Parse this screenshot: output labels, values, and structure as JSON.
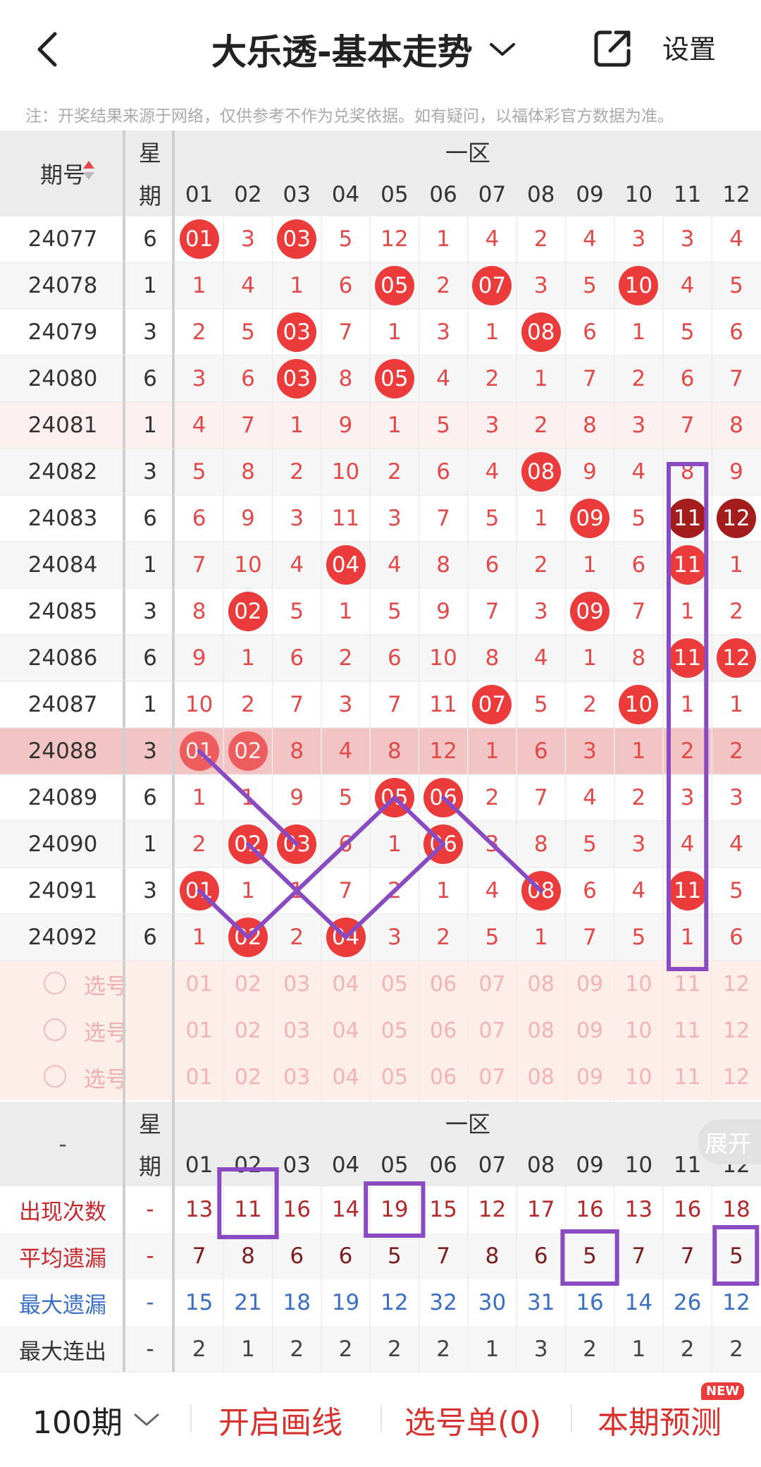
{
  "header": {
    "title": "大乐透-基本走势",
    "settings_label": "设置"
  },
  "notice": "注：开奖结果来源于网络，仅供参考不作为兑奖依据。如有疑问，以福体彩官方数据为准。",
  "table": {
    "col_issue": "期号",
    "col_week_top": "星",
    "col_week_bottom": "期",
    "zone_label": "一区",
    "columns": [
      "01",
      "02",
      "03",
      "04",
      "05",
      "06",
      "07",
      "08",
      "09",
      "10",
      "11",
      "12"
    ],
    "rows": [
      {
        "issue": "24077",
        "week": "6",
        "cells": [
          "01",
          "3",
          "03",
          "5",
          "12",
          "1",
          "4",
          "2",
          "4",
          "3",
          "3",
          "4"
        ],
        "hits": [
          1,
          0,
          1,
          0,
          0,
          0,
          0,
          0,
          0,
          0,
          0,
          0
        ]
      },
      {
        "issue": "24078",
        "week": "1",
        "cells": [
          "1",
          "4",
          "1",
          "6",
          "05",
          "2",
          "07",
          "3",
          "5",
          "10",
          "4",
          "5"
        ],
        "hits": [
          0,
          0,
          0,
          0,
          1,
          0,
          1,
          0,
          0,
          1,
          0,
          0
        ]
      },
      {
        "issue": "24079",
        "week": "3",
        "cells": [
          "2",
          "5",
          "03",
          "7",
          "1",
          "3",
          "1",
          "08",
          "6",
          "1",
          "5",
          "6"
        ],
        "hits": [
          0,
          0,
          1,
          0,
          0,
          0,
          0,
          1,
          0,
          0,
          0,
          0
        ]
      },
      {
        "issue": "24080",
        "week": "6",
        "cells": [
          "3",
          "6",
          "03",
          "8",
          "05",
          "4",
          "2",
          "1",
          "7",
          "2",
          "6",
          "7"
        ],
        "hits": [
          0,
          0,
          1,
          0,
          1,
          0,
          0,
          0,
          0,
          0,
          0,
          0
        ]
      },
      {
        "issue": "24081",
        "week": "1",
        "cells": [
          "4",
          "7",
          "1",
          "9",
          "1",
          "5",
          "3",
          "2",
          "8",
          "3",
          "7",
          "8"
        ],
        "hits": [
          0,
          0,
          0,
          0,
          0,
          0,
          0,
          0,
          0,
          0,
          0,
          0
        ]
      },
      {
        "issue": "24082",
        "week": "3",
        "cells": [
          "5",
          "8",
          "2",
          "10",
          "2",
          "6",
          "4",
          "08",
          "9",
          "4",
          "8",
          "9"
        ],
        "hits": [
          0,
          0,
          0,
          0,
          0,
          0,
          0,
          1,
          0,
          0,
          0,
          0
        ]
      },
      {
        "issue": "24083",
        "week": "6",
        "cells": [
          "6",
          "9",
          "3",
          "11",
          "3",
          "7",
          "5",
          "1",
          "09",
          "5",
          "11",
          "12"
        ],
        "hits": [
          0,
          0,
          0,
          0,
          0,
          0,
          0,
          0,
          1,
          0,
          2,
          2
        ]
      },
      {
        "issue": "24084",
        "week": "1",
        "cells": [
          "7",
          "10",
          "4",
          "04",
          "4",
          "8",
          "6",
          "2",
          "1",
          "6",
          "11",
          "1"
        ],
        "hits": [
          0,
          0,
          0,
          1,
          0,
          0,
          0,
          0,
          0,
          0,
          1,
          0
        ]
      },
      {
        "issue": "24085",
        "week": "3",
        "cells": [
          "8",
          "02",
          "5",
          "1",
          "5",
          "9",
          "7",
          "3",
          "09",
          "7",
          "1",
          "2"
        ],
        "hits": [
          0,
          1,
          0,
          0,
          0,
          0,
          0,
          0,
          1,
          0,
          0,
          0
        ]
      },
      {
        "issue": "24086",
        "week": "6",
        "cells": [
          "9",
          "1",
          "6",
          "2",
          "6",
          "10",
          "8",
          "4",
          "1",
          "8",
          "11",
          "12"
        ],
        "hits": [
          0,
          0,
          0,
          0,
          0,
          0,
          0,
          0,
          0,
          0,
          1,
          1
        ]
      },
      {
        "issue": "24087",
        "week": "1",
        "cells": [
          "10",
          "2",
          "7",
          "3",
          "7",
          "11",
          "07",
          "5",
          "2",
          "10",
          "1",
          "1"
        ],
        "hits": [
          0,
          0,
          0,
          0,
          0,
          0,
          1,
          0,
          0,
          1,
          0,
          0
        ]
      },
      {
        "issue": "24088",
        "week": "3",
        "cells": [
          "01",
          "02",
          "8",
          "4",
          "8",
          "12",
          "1",
          "6",
          "3",
          "1",
          "2",
          "2"
        ],
        "hits": [
          1,
          1,
          0,
          0,
          0,
          0,
          0,
          0,
          0,
          0,
          0,
          0
        ]
      },
      {
        "issue": "24089",
        "week": "6",
        "cells": [
          "1",
          "1",
          "9",
          "5",
          "05",
          "06",
          "2",
          "7",
          "4",
          "2",
          "3",
          "3"
        ],
        "hits": [
          0,
          0,
          0,
          0,
          1,
          1,
          0,
          0,
          0,
          0,
          0,
          0
        ]
      },
      {
        "issue": "24090",
        "week": "1",
        "cells": [
          "2",
          "02",
          "03",
          "6",
          "1",
          "06",
          "3",
          "8",
          "5",
          "3",
          "4",
          "4"
        ],
        "hits": [
          0,
          1,
          1,
          0,
          0,
          1,
          0,
          0,
          0,
          0,
          0,
          0
        ]
      },
      {
        "issue": "24091",
        "week": "3",
        "cells": [
          "01",
          "1",
          "1",
          "7",
          "2",
          "1",
          "4",
          "08",
          "6",
          "4",
          "11",
          "5"
        ],
        "hits": [
          1,
          0,
          0,
          0,
          0,
          0,
          0,
          1,
          0,
          0,
          1,
          0
        ]
      },
      {
        "issue": "24092",
        "week": "6",
        "cells": [
          "1",
          "02",
          "2",
          "04",
          "3",
          "2",
          "5",
          "1",
          "7",
          "5",
          "1",
          "6"
        ],
        "hits": [
          0,
          1,
          0,
          1,
          0,
          0,
          0,
          0,
          0,
          0,
          0,
          0
        ]
      }
    ],
    "highlight_issue": "24088",
    "pick_rows": [
      {
        "label": "选号"
      },
      {
        "label": "选号"
      },
      {
        "label": "选号"
      }
    ],
    "stats_header_left": "-",
    "stats": [
      {
        "label": "出现次数",
        "week": "-",
        "values": [
          "13",
          "11",
          "16",
          "14",
          "19",
          "15",
          "12",
          "17",
          "16",
          "13",
          "16",
          "18"
        ],
        "label_color": "#c8282d",
        "value_color": "#b22a2a"
      },
      {
        "label": "平均遗漏",
        "week": "-",
        "values": [
          "7",
          "8",
          "6",
          "6",
          "5",
          "7",
          "8",
          "6",
          "5",
          "7",
          "7",
          "5"
        ],
        "label_color": "#c8282d",
        "value_color": "#7a1e1e"
      },
      {
        "label": "最大遗漏",
        "week": "-",
        "values": [
          "15",
          "21",
          "18",
          "19",
          "12",
          "32",
          "30",
          "31",
          "16",
          "14",
          "26",
          "12"
        ],
        "label_color": "#3a6fc4",
        "value_color": "#3a6fc4"
      },
      {
        "label": "最大连出",
        "week": "-",
        "values": [
          "2",
          "1",
          "2",
          "2",
          "2",
          "2",
          "1",
          "3",
          "2",
          "1",
          "2",
          "2"
        ],
        "label_color": "#333333",
        "value_color": "#444444"
      }
    ],
    "expand_label": "展开"
  },
  "bottom": {
    "period_label": "100期",
    "draw_line_label": "开启画线",
    "pick_list_label": "选号单(0)",
    "predict_label": "本期预测",
    "new_badge": "NEW"
  },
  "colors": {
    "accent": "#ec3b3b",
    "dark_ball": "#a31d1d",
    "annotation": "#8a4bc2",
    "highlight_row": "#f3c4c4"
  }
}
